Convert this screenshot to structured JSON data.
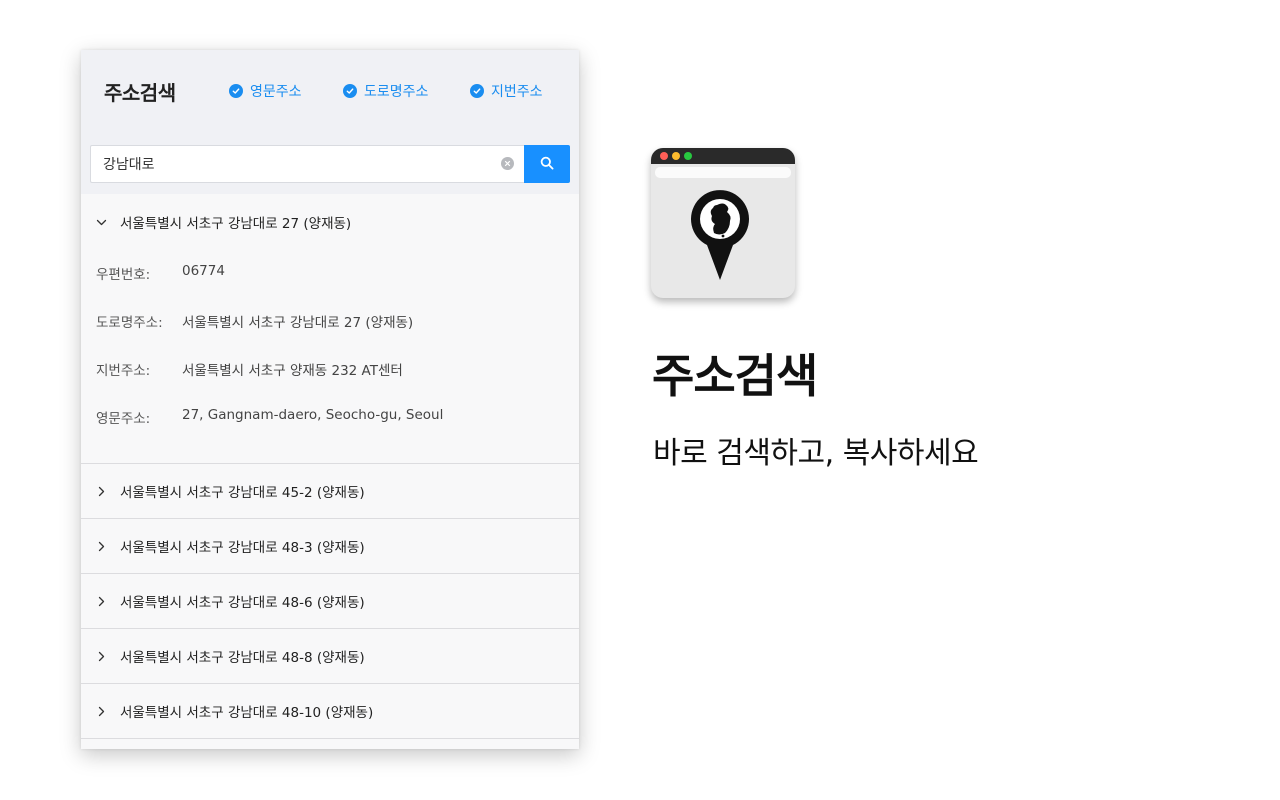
{
  "popup": {
    "title": "주소검색",
    "options": [
      {
        "label": "영문주소",
        "checked": true
      },
      {
        "label": "도로명주소",
        "checked": true
      },
      {
        "label": "지번주소",
        "checked": true
      }
    ],
    "search": {
      "value": "강남대로",
      "placeholder": ""
    },
    "expanded_result": {
      "title": "서울특별시 서초구 강남대로 27 (양재동)",
      "details": [
        {
          "label": "우편번호:",
          "value": "06774"
        },
        {
          "label": "도로명주소:",
          "value": "서울특별시 서초구 강남대로 27 (양재동)"
        },
        {
          "label": "지번주소:",
          "value": "서울특별시 서초구 양재동 232 AT센터"
        },
        {
          "label": "영문주소:",
          "value": "27, Gangnam-daero, Seocho-gu, Seoul"
        }
      ]
    },
    "results": [
      "서울특별시 서초구 강남대로 45-2 (양재동)",
      "서울특별시 서초구 강남대로 48-3 (양재동)",
      "서울특별시 서초구 강남대로 48-6 (양재동)",
      "서울특별시 서초구 강남대로 48-8 (양재동)",
      "서울특별시 서초구 강남대로 48-10 (양재동)"
    ]
  },
  "promo": {
    "title": "주소검색",
    "subtitle": "바로 검색하고, 복사하세요",
    "icon": "map-pin-korea-icon"
  },
  "colors": {
    "accent": "#1890ff",
    "header_bg": "#f0f1f5",
    "window_dots": [
      "#ff5f57",
      "#febc2e",
      "#28c840"
    ]
  }
}
